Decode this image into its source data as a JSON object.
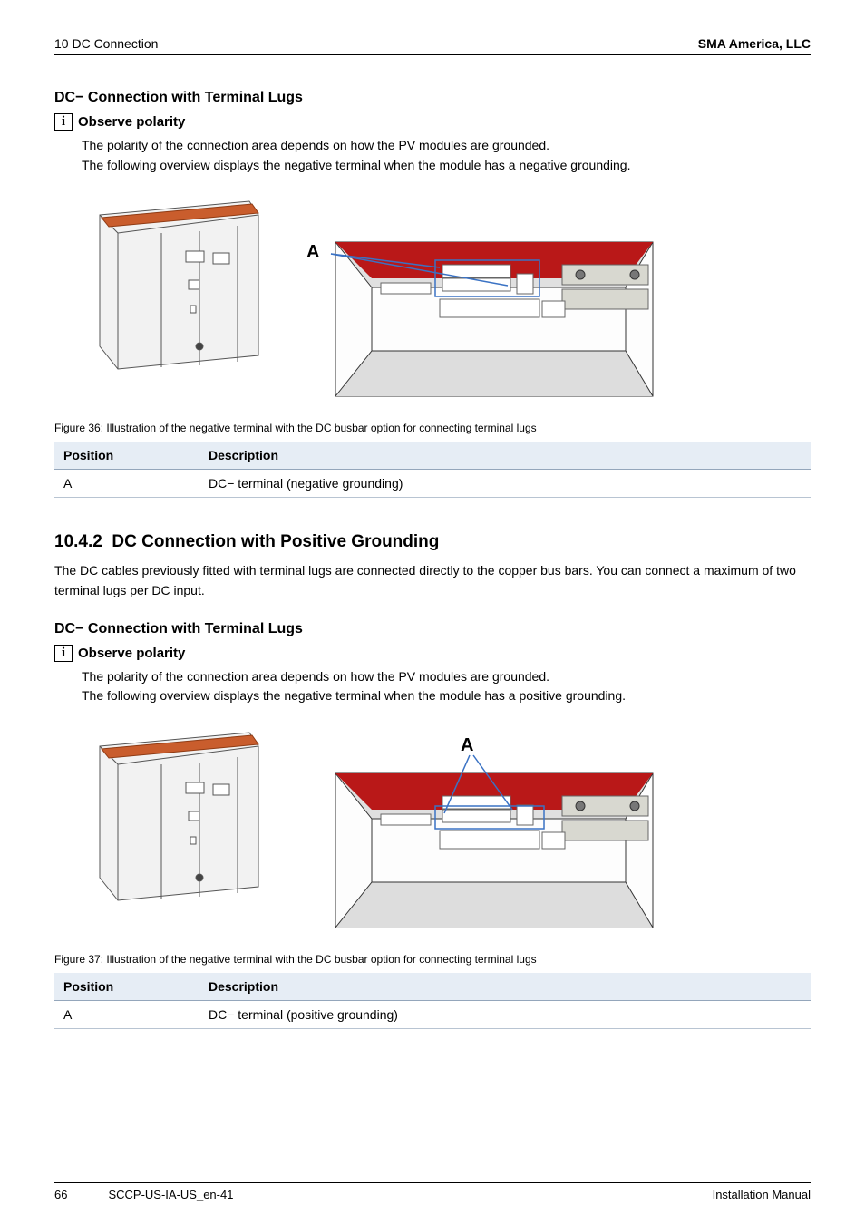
{
  "header": {
    "left": "10  DC Connection",
    "right": "SMA America, LLC"
  },
  "section1": {
    "heading": "DC− Connection with Terminal Lugs",
    "info_title": "Observe polarity",
    "info_p1": "The polarity of the connection area depends on how the PV modules are grounded.",
    "info_p2": "The following overview displays the negative terminal when the module has a negative grounding.",
    "label_A": "A",
    "caption": "Figure 36:  Illustration of the negative terminal with the DC busbar option for connecting terminal lugs",
    "table": {
      "h_pos": "Position",
      "h_desc": "Description",
      "rows": [
        {
          "pos": "A",
          "desc": "DC− terminal (negative grounding)"
        }
      ]
    }
  },
  "section2": {
    "number": "10.4.2",
    "title": "DC Connection with Positive Grounding",
    "para": "The DC cables previously fitted with terminal lugs are connected directly to the copper bus bars. You can connect a maximum of two terminal lugs per DC input.",
    "sub_heading": "DC− Connection with Terminal Lugs",
    "info_title": "Observe polarity",
    "info_p1": "The polarity of the connection area depends on how the PV modules are grounded.",
    "info_p2": "The following overview displays the negative terminal when the module has a positive grounding.",
    "label_A": "A",
    "caption": "Figure 37:  Illustration of the negative terminal with the DC busbar option for connecting terminal lugs",
    "table": {
      "h_pos": "Position",
      "h_desc": "Description",
      "rows": [
        {
          "pos": "A",
          "desc": "DC− terminal (positive grounding)"
        }
      ]
    }
  },
  "footer": {
    "page": "66",
    "docid": "SCCP-US-IA-US_en-41",
    "right": "Installation Manual"
  }
}
